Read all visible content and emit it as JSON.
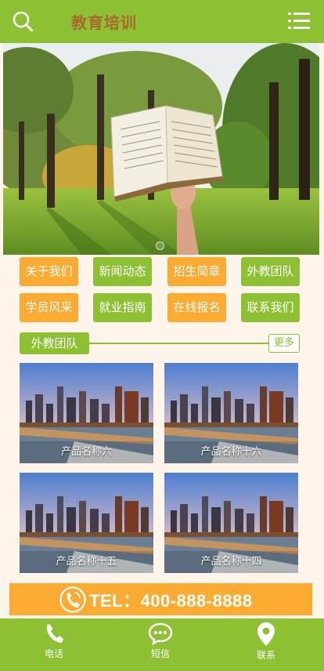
{
  "header": {
    "title": "教育培训",
    "icons": [
      "search-icon",
      "menu-icon"
    ]
  },
  "nav": [
    {
      "label": "关于我们",
      "color": "#fbaa32"
    },
    {
      "label": "新闻动态",
      "color": "#8dc033"
    },
    {
      "label": "招生简章",
      "color": "#fbaa32"
    },
    {
      "label": "外教团队",
      "color": "#8dc033"
    },
    {
      "label": "学员风采",
      "color": "#fbaa32"
    },
    {
      "label": "就业指南",
      "color": "#8dc033"
    },
    {
      "label": "在线报名",
      "color": "#fbaa32"
    },
    {
      "label": "联系我们",
      "color": "#8dc033"
    }
  ],
  "section": {
    "title": "外教团队",
    "more": "更多"
  },
  "products": [
    {
      "name": "产品名称六"
    },
    {
      "name": "产品名称十六"
    },
    {
      "name": "产品名称十五"
    },
    {
      "name": "产品名称十四"
    }
  ],
  "tel": {
    "text": "TEL：400-888-8888",
    "icon": "phone-icon"
  },
  "footer": {
    "items": [
      {
        "label": "电话",
        "icon": "phone-icon"
      },
      {
        "label": "短信",
        "icon": "message-icon"
      },
      {
        "label": "联系",
        "icon": "location-pin-icon"
      }
    ]
  },
  "colors": {
    "primary_green": "#8dc033",
    "accent_orange": "#fbaa32",
    "title_brown": "#a86a2b",
    "background": "#fdf5ea"
  }
}
